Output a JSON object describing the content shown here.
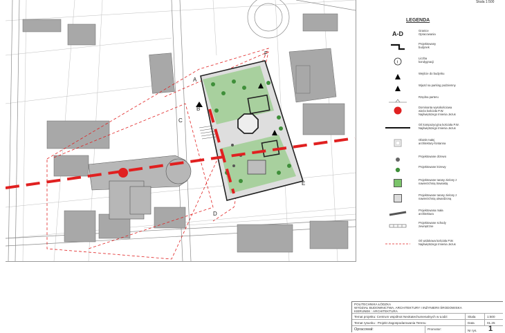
{
  "header": {
    "scale_label": "Skala 1:500"
  },
  "legend": {
    "title": "LEGENDA",
    "items": [
      {
        "symbol_text": "A-D",
        "label": "Granice\nOpracowania",
        "icon": "boundary-letters"
      },
      {
        "symbol_text": "",
        "label": "Projektowany\nbudynek",
        "icon": "building-outline"
      },
      {
        "symbol_text": "i",
        "label": "Liczba\nkondygnacji",
        "icon": "circle-i"
      },
      {
        "symbol_text": "",
        "label": "Wejście do budynku",
        "icon": "triangle-solid"
      },
      {
        "symbol_text": "",
        "label": "Wjazd na parking podziemny",
        "icon": "triangle-solid"
      },
      {
        "symbol_text": "",
        "label": "Rzędna parteru",
        "icon": "level-mark"
      },
      {
        "symbol_text": "",
        "label": "Dominanta wysokościowa\nwieża kościoła P.W.\nNajświętszego Imienia Jezus",
        "icon": "red-dot"
      },
      {
        "symbol_text": "",
        "label": "Oś kompozycyjna kościoła P.W.\nNajświętszego Imienia Jezus",
        "icon": "thick-line"
      },
      {
        "symbol_text": "",
        "label": "Obiekt małej\narchitektury-fontanna",
        "icon": "square-outline"
      },
      {
        "symbol_text": "",
        "label": "Projektowane drzewo",
        "icon": "tree-dot"
      },
      {
        "symbol_text": "",
        "label": "Projektowane krzewy",
        "icon": "shrub-dot"
      },
      {
        "symbol_text": "",
        "label": "Projektowane tarasy zielony z\nnawierzchnią trawiastą",
        "icon": "green-square"
      },
      {
        "symbol_text": "",
        "label": "Projektowane tarasy zielony z\nnawierzchnią utwardzoną",
        "icon": "grey-square"
      },
      {
        "symbol_text": "",
        "label": "Projektowana mała\narchitektura",
        "icon": "dark-bar"
      },
      {
        "symbol_text": "",
        "label": "Projektowane schody\nzewnętrzne",
        "icon": "stairs"
      },
      {
        "symbol_text": "",
        "label": "Oś widokowa kościoła P.W.\nNajświętszego Imienia Jezus",
        "icon": "dashed-red"
      }
    ]
  },
  "plan": {
    "point_labels": [
      "A",
      "B",
      "C",
      "D",
      "E",
      "F"
    ],
    "colors": {
      "axis_red": "#e02020",
      "green": "#7bc46a",
      "paving": "#d9d9d9",
      "building": "#a8a8a8"
    }
  },
  "title_block": {
    "lines": [
      "POLITECHNIKA ŁÓDZKA",
      "WYDZIAŁ BUDOWNICTWA, ARCHITEKTURY I INŻYNIERII ŚRODOWISKA",
      "KIERUNEK : ARCHITEKTURA"
    ],
    "project_label": "Temat projektu: Centrum współnot Neokatechumenalnych w Łodzi",
    "drawing_label": "Temat rysunku : Projekt Zagospodarowania Terenu",
    "scale_label": "Skala",
    "scale_value": "1:500",
    "date_label": "Data",
    "date_value": "01.25",
    "author_label": "Opracował:",
    "promoter_label": "Promotor:",
    "sheet_label": "Nr rys.",
    "sheet_value": "1"
  }
}
